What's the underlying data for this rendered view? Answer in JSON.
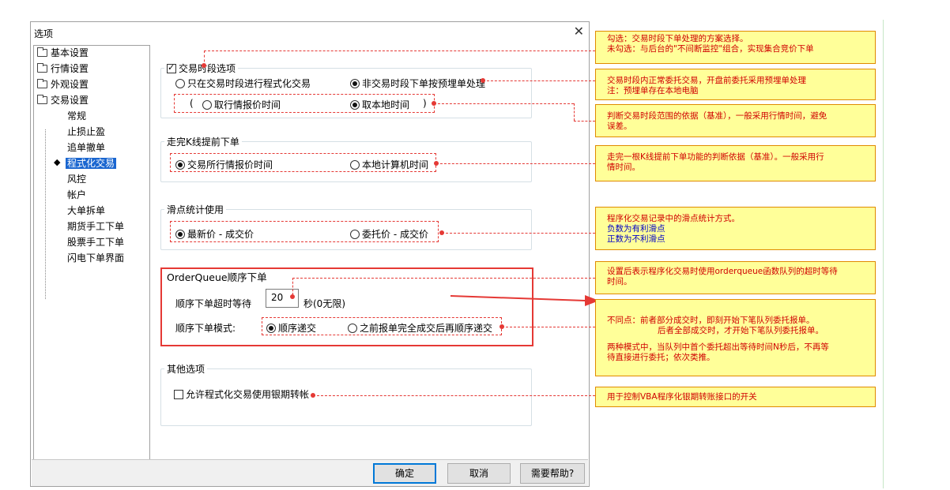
{
  "dialog": {
    "title": "选项",
    "close_glyph": "✕"
  },
  "tree": {
    "top": [
      {
        "label": "基本设置"
      },
      {
        "label": "行情设置"
      },
      {
        "label": "外观设置"
      },
      {
        "label": "交易设置"
      }
    ],
    "children": [
      {
        "label": "常规"
      },
      {
        "label": "止损止盈"
      },
      {
        "label": "追单撤单"
      },
      {
        "label": "程式化交易",
        "selected": true
      },
      {
        "label": "风控"
      },
      {
        "label": "帐户"
      },
      {
        "label": "大单拆单"
      },
      {
        "label": "期货手工下单"
      },
      {
        "label": "股票手工下单"
      },
      {
        "label": "闪电下单界面"
      }
    ],
    "selected_marker": "◆"
  },
  "panel": {
    "trading_period": {
      "checkbox_label": "交易时段选项",
      "checked": true,
      "opt1": "只在交易时段进行程式化交易",
      "opt2": "非交易时段下单按预埋单处理",
      "selected": 2,
      "sub_open": "(",
      "sub_opt1": "取行情报价时间",
      "sub_opt2": "取本地时间",
      "sub_close": ")",
      "sub_selected": 2
    },
    "kline": {
      "title": "走完K线提前下单",
      "opt1": "交易所行情报价时间",
      "opt2": "本地计算机时间",
      "selected": 1
    },
    "slippage": {
      "title": "滑点统计使用",
      "opt1": "最新价 - 成交价",
      "opt2": "委托价 - 成交价",
      "selected": 1
    },
    "order_queue": {
      "title": "OrderQueue顺序下单",
      "timeout_label": "顺序下单超时等待",
      "timeout_value": "20",
      "timeout_unit": "秒(0无限)",
      "mode_label": "顺序下单模式:",
      "opt1": "顺序递交",
      "opt2": "之前报单完全成交后再顺序递交",
      "selected": 1
    },
    "other": {
      "title": "其他选项",
      "checkbox_label": "允许程式化交易使用银期转帐",
      "checked": false
    }
  },
  "footer": {
    "ok": "确定",
    "cancel": "取消",
    "help": "需要帮助?"
  },
  "notes": {
    "n1_line1": "勾选：交易时段下单处理的方案选择。",
    "n1_line2": "未勾选：与后台的\"不间断监控\"组合，实现集合竞价下单",
    "n2_line1": "交易时段内正常委托交易，开盘前委托采用预埋单处理",
    "n2_line2": "注：预埋单存在本地电脑",
    "n3_line1": "判断交易时段范围的依据（基准），一般采用行情时间，避免",
    "n3_line2": "误差。",
    "n4_line1": "走完一根K线提前下单功能的判断依据（基准）。一般采用行",
    "n4_line2": "情时间。",
    "n5_line1": "程序化交易记录中的滑点统计方式。",
    "n5_line2": "负数为有利滑点",
    "n5_line3": "正数为不利滑点",
    "n6_line1": "设置后表示程序化交易时使用orderqueue函数队列的超时等待",
    "n6_line2": "时间。",
    "n7_line1": "不同点：前者部分成交时，即刻开始下笔队列委托报单。",
    "n7_line2": "后者全部成交时，才开始下笔队列委托报单。",
    "n7_line3": "两种模式中，当队列中首个委托超出等待时间N秒后，不再等",
    "n7_line4": "待直接进行委托；依次类推。",
    "n8_line1": "用于控制VBA程序化银期转账接口的开关"
  }
}
